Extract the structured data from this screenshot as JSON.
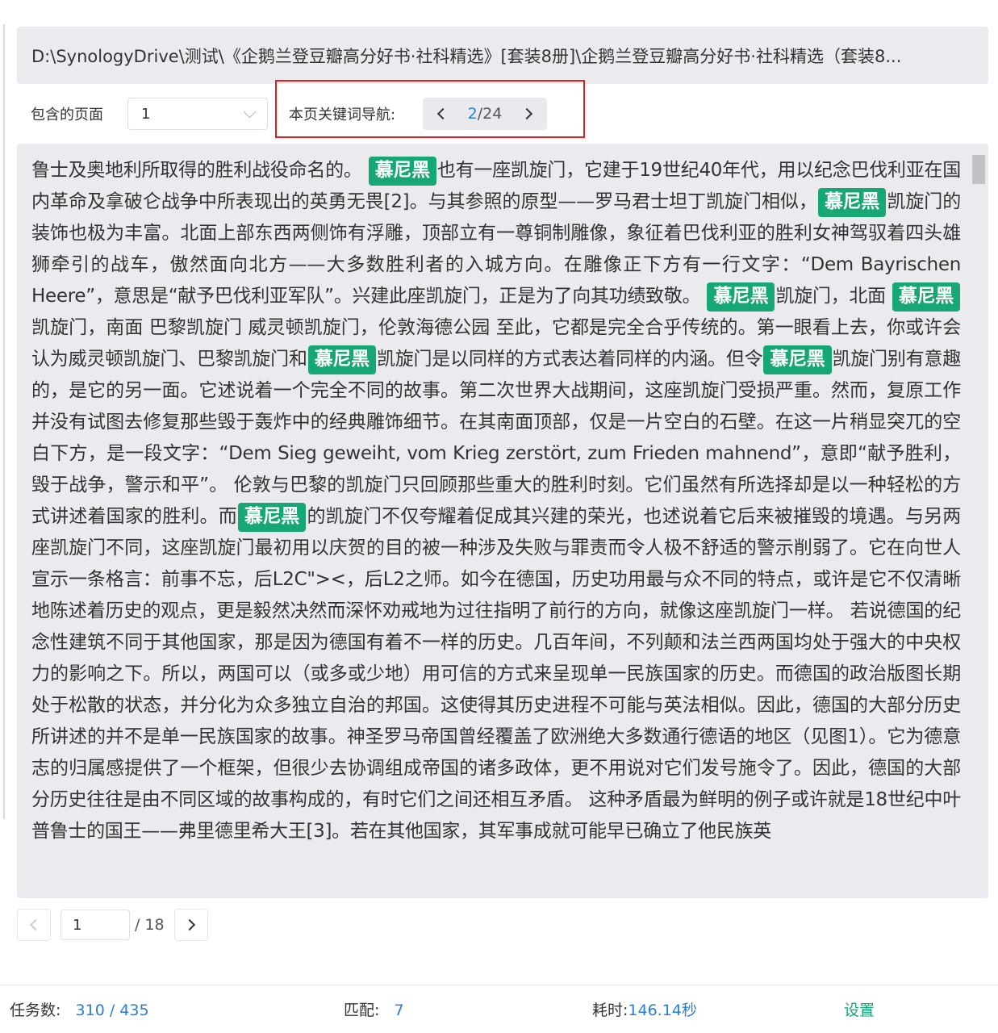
{
  "path": {
    "text": "D:\\SynologyDrive\\测试\\《企鹅兰登豆瓣高分好书·社科精选》[套装8册]\\企鹅兰登豆瓣高分好书·社科精选（套装8..."
  },
  "filters": {
    "pages_label": "包含的页面",
    "pages_value": "1",
    "keyword_nav_label": "本页关键词导航:",
    "keyword_current": "2",
    "keyword_separator": "/",
    "keyword_total": "24"
  },
  "content": {
    "keyword": "慕尼黑",
    "segments": [
      "鲁士及奥地利所取得的胜利战役命名的。 ",
      "也有一座凯旋门，它建于19世纪40年代，用以纪念巴伐利亚在国内革命及拿破仑战争中所表现出的英勇无畏[2]。与其参照的原型——罗马君士坦丁凯旋门相似，",
      "凯旋门的装饰也极为丰富。北面上部东西两侧饰有浮雕，顶部立有一尊铜制雕像，象征着巴伐利亚的胜利女神驾驭着四头雄狮牵引的战车，傲然面向北方——大多数胜利者的入城方向。在雕像正下方有一行文字：“Dem Bayrischen Heere”，意思是“献予巴伐利亚军队”。兴建此座凯旋门，正是为了向其功绩致敬。 ",
      "凯旋门，北面 ",
      "凯旋门，南面 巴黎凯旋门 威灵顿凯旋门，伦敦海德公园 至此，它都是完全合乎传统的。第一眼看上去，你或许会认为威灵顿凯旋门、巴黎凯旋门和",
      "凯旋门是以同样的方式表达着同样的内涵。但令",
      "凯旋门别有意趣的，是它的另一面。它述说着一个完全不同的故事。第二次世界大战期间，这座凯旋门受损严重。然而，复原工作并没有试图去修复那些毁于轰炸中的经典雕饰细节。在其南面顶部，仅是一片空白的石壁。在这一片稍显突兀的空白下方，是一段文字：“Dem Sieg geweiht, vom Krieg zerstört, zum Frieden mahnend”，意即“献予胜利，毁于战争，警示和平”。 伦敦与巴黎的凯旋门只回顾那些重大的胜利时刻。它们虽然有所选择却是以一种轻松的方式讲述着国家的胜利。而",
      "的凯旋门不仅夸耀着促成其兴建的荣光，也述说着它后来被摧毁的境遇。与另两座凯旋门不同，这座凯旋门最初用以庆贺的目的被一种涉及失败与罪责而令人极不舒适的警示削弱了。它在向世人宣示一条格言：前事不忘，后L2C\"><，后L2之师。如今在德国，历史功用最与众不同的特点，或许是它不仅清晰地陈述着历史的观点，更是毅然决然而深怀劝戒地为过往指明了前行的方向，就像这座凯旋门一样。 若说德国的纪念性建筑不同于其他国家，那是因为德国有着不一样的历史。几百年间，不列颠和法兰西两国均处于强大的中央权力的影响之下。所以，两国可以（或多或少地）用可信的方式来呈现单一民族国家的历史。而德国的政治版图长期处于松散的状态，并分化为众多独立自治的邦国。这使得其历史进程不可能与英法相似。因此，德国的大部分历史所讲述的并不是单一民族国家的故事。神圣罗马帝国曾经覆盖了欧洲绝大多数通行德语的地区（见图1）。它为德意志的归属感提供了一个框架，但很少去协调组成帝国的诸多政体，更不用说对它们发号施令了。因此，德国的大部分历史往往是由不同区域的故事构成的，有时它们之间还相互矛盾。 这种矛盾最为鲜明的例子或许就是18世纪中叶普鲁士的国王——弗里德里希大王[3]。若在其他国家，其军事成就可能早已确立了他民族英"
    ]
  },
  "pager": {
    "current": "1",
    "total": "/ 18"
  },
  "footer": {
    "tasks_label": "任务数:",
    "tasks_value": "310 / 435",
    "match_label": "匹配:",
    "match_value": "7",
    "time_label": "耗时:",
    "time_value": "146.14秒",
    "settings_label": "设置"
  },
  "colors": {
    "keyword_bg": "#17a774",
    "accent_blue": "#2a7fd4",
    "highlight_border": "#e02020",
    "panel_bg": "#ebebef"
  }
}
